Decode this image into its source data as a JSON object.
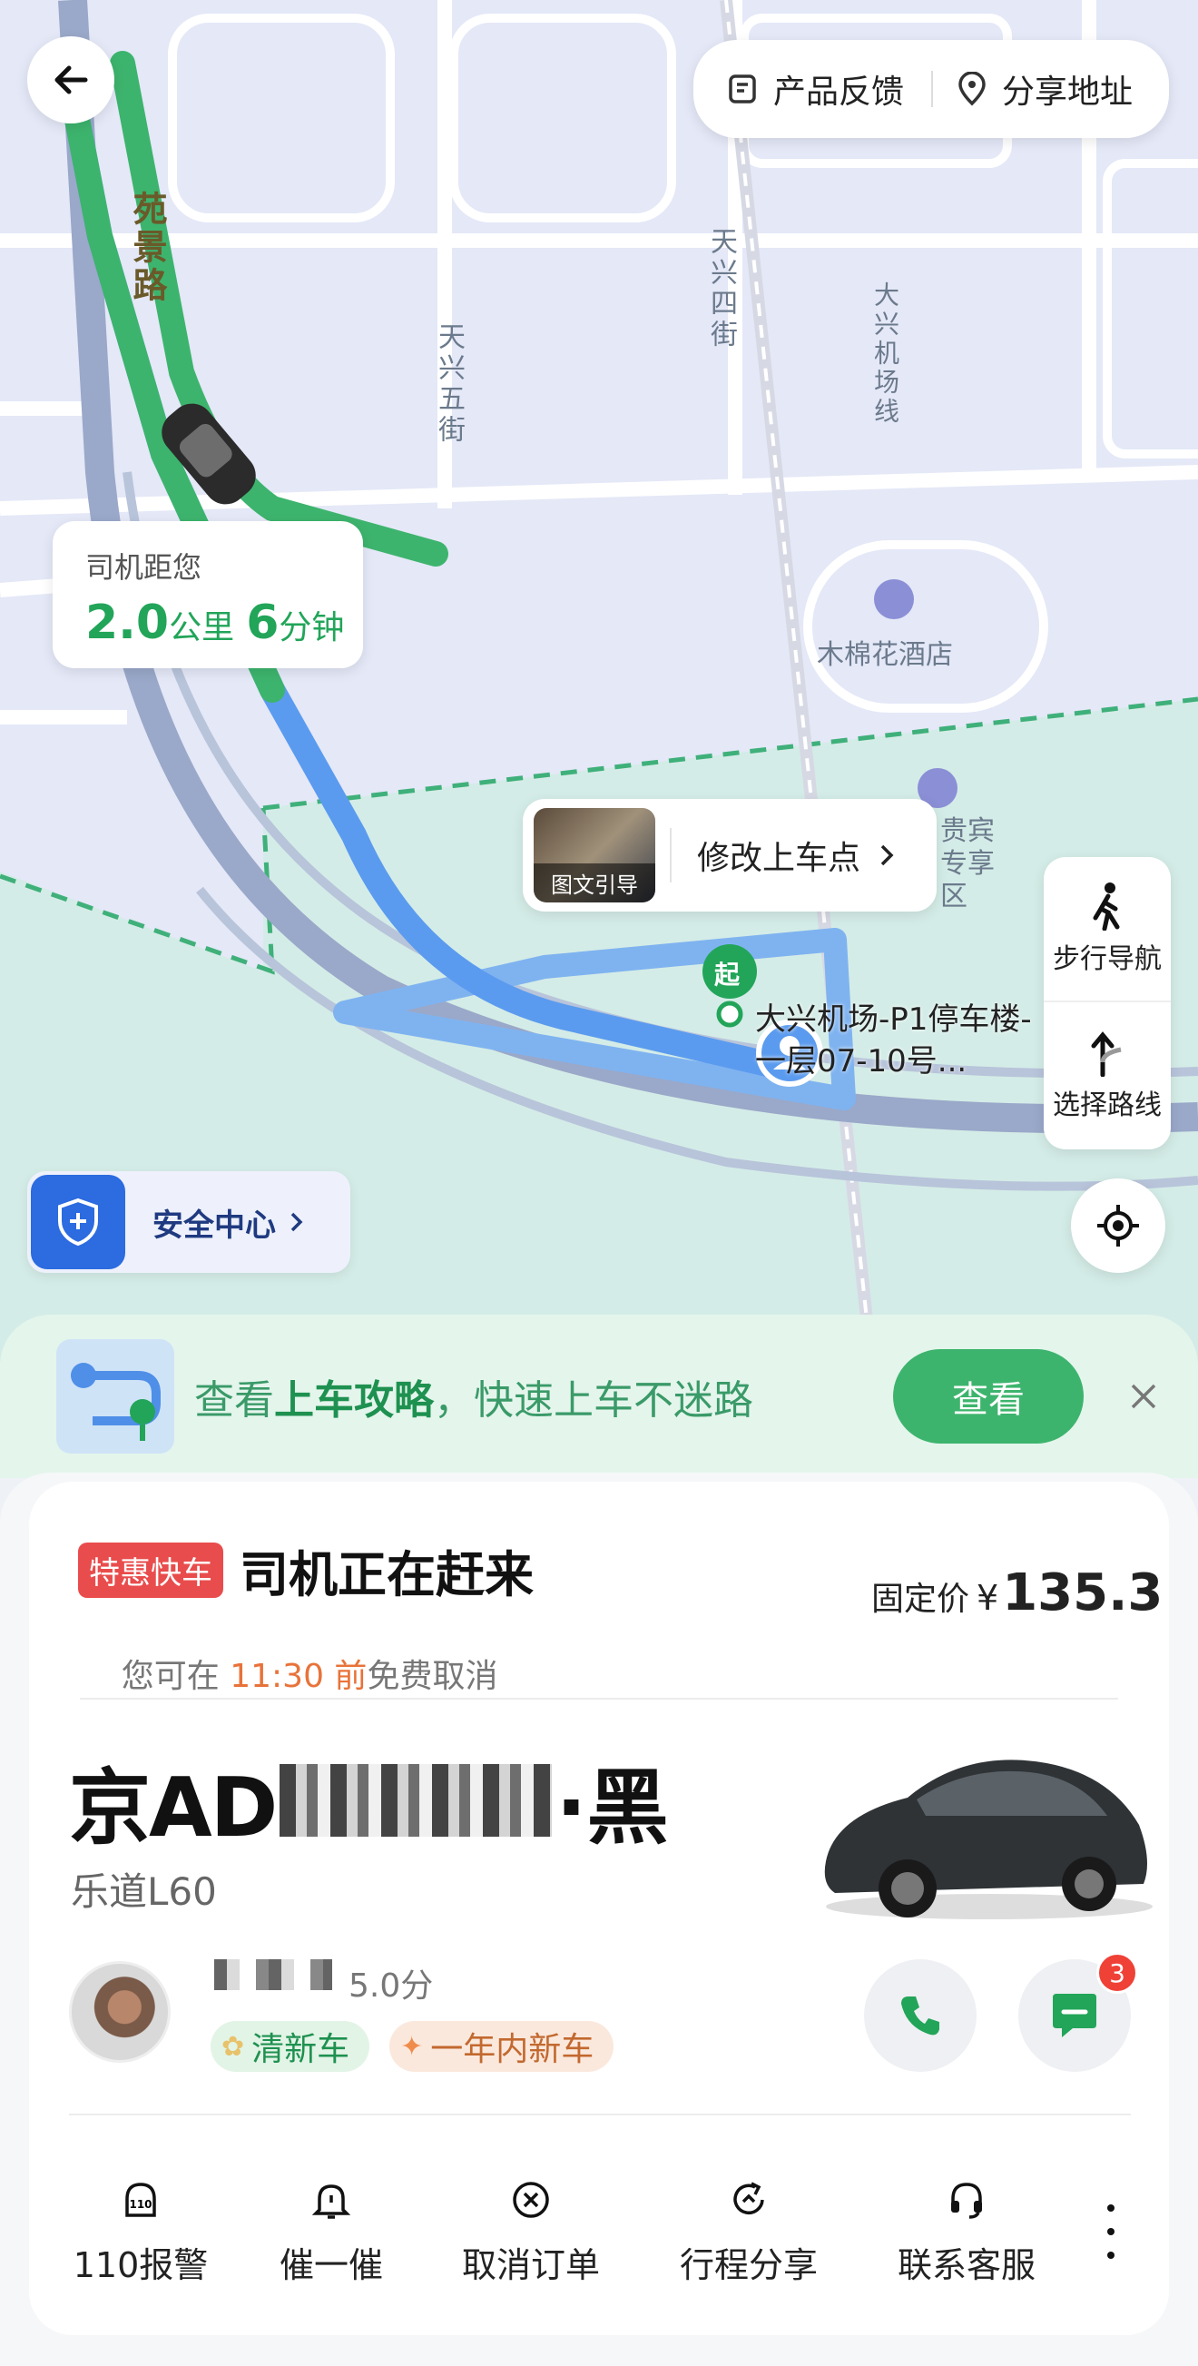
{
  "map": {
    "road_labels": [
      "苑景路",
      "天兴五街",
      "天兴四街",
      "大兴机场线"
    ],
    "poi_hotel": "木棉花酒店",
    "poi_vip": "贵宾\n专享区",
    "start_marker": "起",
    "pickup_label_line1": "大兴机场-P1停车楼-",
    "pickup_label_line2": "一层07-10号...",
    "colors": {
      "route_green": "#3db46d",
      "route_blue": "#5b9bef",
      "accent_green": "#22a559"
    }
  },
  "top": {
    "feedback_label": "产品反馈",
    "share_address_label": "分享地址"
  },
  "driver_distance": {
    "caption": "司机距您",
    "distance_value": "2.0",
    "distance_unit": "公里",
    "time_value": "6",
    "time_unit": "分钟"
  },
  "pickup_popup": {
    "thumb_caption": "图文引导",
    "modify_label": "修改上车点"
  },
  "side_buttons": {
    "walk_nav": "步行导航",
    "choose_route": "选择路线"
  },
  "safety": {
    "label": "安全中心"
  },
  "tips_banner": {
    "prefix": "查看",
    "highlight": "上车攻略",
    "suffix": "，快速上车不迷路",
    "button": "查看"
  },
  "order": {
    "badge": "特惠快车",
    "status": "司机正在赶来",
    "cancel_prefix": "您可在 ",
    "cancel_time": "11:30",
    "cancel_before": " 前",
    "cancel_suffix": "免费取消",
    "price_label": "固定价",
    "price_currency": "¥",
    "price_value": "135.3"
  },
  "vehicle": {
    "plate": "京AD",
    "plate_suffix": "·黑",
    "model": "乐道L60"
  },
  "driver": {
    "rating": "5.0分",
    "tags": [
      "清新车",
      "一年内新车"
    ],
    "message_badge": "3"
  },
  "actions": [
    "110报警",
    "催一催",
    "取消订单",
    "行程分享",
    "联系客服"
  ]
}
